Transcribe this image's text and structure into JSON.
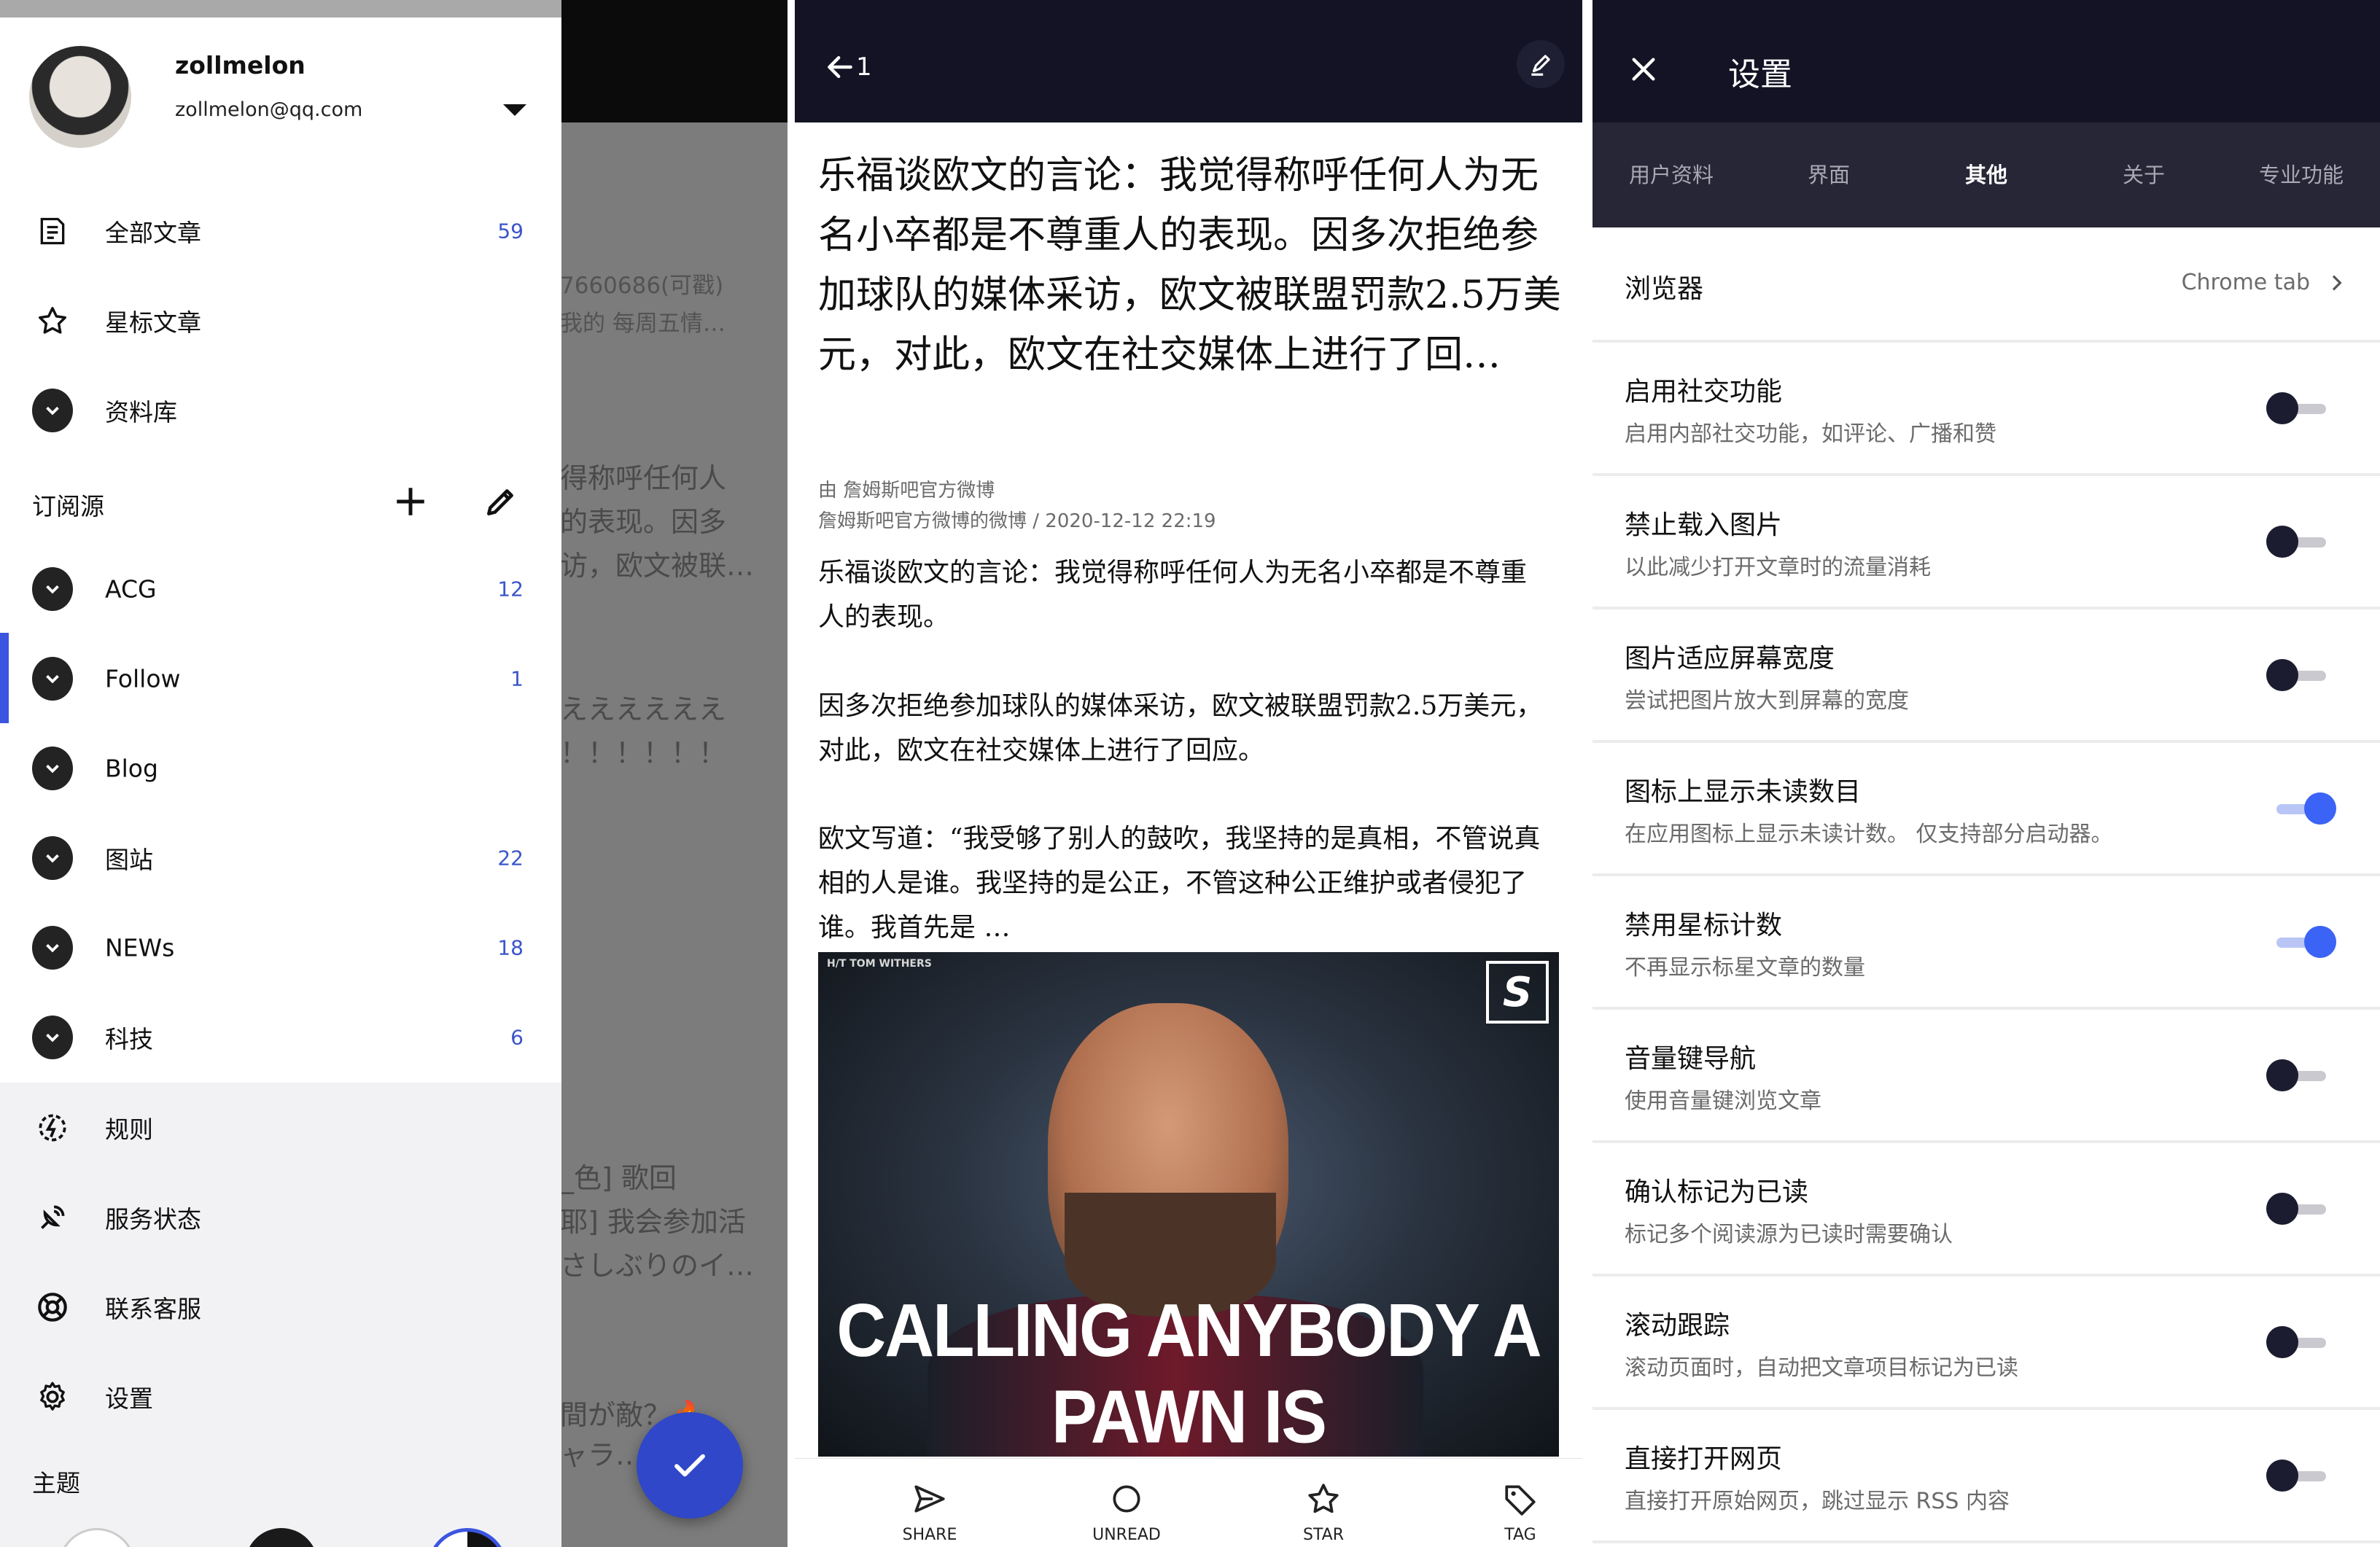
{
  "drawer": {
    "user": {
      "name": "zollmelon",
      "email": "zollmelon@qq.com"
    },
    "items": [
      {
        "label": "全部文章",
        "count": "59",
        "icon": "article-icon"
      },
      {
        "label": "星标文章",
        "count": "",
        "icon": "star-icon"
      },
      {
        "label": "资料库",
        "count": "",
        "icon": "chevron-down-icon"
      }
    ],
    "feeds_title": "订阅源",
    "feeds": [
      {
        "label": "ACG",
        "count": "12"
      },
      {
        "label": "Follow",
        "count": "1"
      },
      {
        "label": "Blog",
        "count": ""
      },
      {
        "label": "图站",
        "count": "22"
      },
      {
        "label": "NEWs",
        "count": "18"
      },
      {
        "label": "科技",
        "count": "6"
      }
    ],
    "bottom": [
      {
        "label": "规则",
        "icon": "rules-icon"
      },
      {
        "label": "服务状态",
        "icon": "satellite-icon"
      },
      {
        "label": "联系客服",
        "icon": "lifebuoy-icon"
      },
      {
        "label": "设置",
        "icon": "gear-icon"
      }
    ],
    "theme_title": "主题"
  },
  "background_list": [
    "7660686(可戳)",
    "我的 每周五情…",
    "得称呼任何人",
    "的表现。因多",
    "访，欧文被联…",
    "ええええええ",
    "！！！！！！",
    "_色]  歌回",
    "耶] 我会参加活",
    "さしぶりのイ…",
    "間が敵？🔥",
    "ャラ…"
  ],
  "article": {
    "unread_count": "1",
    "title": "乐福谈欧文的言论：我觉得称呼任何人为无名小卒都是不尊重人的表现。因多次拒绝参加球队的媒体采访，欧文被联盟罚款2.5万美元，对此，欧文在社交媒体上进行了回…",
    "meta_line1": "由 詹姆斯吧官方微博",
    "meta_line2": "詹姆斯吧官方微博的微博 / 2020-12-12 22:19",
    "paragraphs": [
      "乐福谈欧文的言论：我觉得称呼任何人为无名小卒都是不尊重人的表现。",
      "因多次拒绝参加球队的媒体采访，欧文被联盟罚款2.5万美元，对此，欧文在社交媒体上进行了回应。",
      "欧文写道：“我受够了别人的鼓吹，我坚持的是真相，不管说真相的人是谁。我坚持的是公正，不管这种公正维护或者侵犯了谁。我首先是 …"
    ],
    "image": {
      "credit": "H/T TOM WITHERS",
      "logo": "S",
      "caption": "CALLING ANYBODY A PAWN IS"
    },
    "toolbar": [
      {
        "label": "SHARE",
        "icon": "send-icon"
      },
      {
        "label": "UNREAD",
        "icon": "circle-icon"
      },
      {
        "label": "STAR",
        "icon": "star-icon"
      },
      {
        "label": "TAG",
        "icon": "tag-icon"
      }
    ]
  },
  "settings": {
    "title": "设置",
    "tabs": [
      "用户资料",
      "界面",
      "其他",
      "关于",
      "专业功能"
    ],
    "active_tab": "其他",
    "browser": {
      "label": "浏览器",
      "value": "Chrome tab"
    },
    "rows": [
      {
        "title": "启用社交功能",
        "sub": "启用内部社交功能，如评论、广播和赞",
        "on": false
      },
      {
        "title": "禁止载入图片",
        "sub": "以此减少打开文章时的流量消耗",
        "on": false
      },
      {
        "title": "图片适应屏幕宽度",
        "sub": "尝试把图片放大到屏幕的宽度",
        "on": false
      },
      {
        "title": "图标上显示未读数目",
        "sub": "在应用图标上显示未读计数。 仅支持部分启动器。",
        "on": true
      },
      {
        "title": "禁用星标计数",
        "sub": "不再显示标星文章的数量",
        "on": true
      },
      {
        "title": "音量键导航",
        "sub": "使用音量键浏览文章",
        "on": false
      },
      {
        "title": "确认标记为已读",
        "sub": "标记多个阅读源为已读时需要确认",
        "on": false
      },
      {
        "title": "滚动跟踪",
        "sub": "滚动页面时，自动把文章项目标记为已读",
        "on": false
      },
      {
        "title": "直接打开网页",
        "sub": "直接打开原始网页，跳过显示 RSS 内容",
        "on": false
      }
    ]
  },
  "colors": {
    "accent": "#3b55e0",
    "toolbar_dark": "#131325",
    "tab_bg": "#272636",
    "toggle_on": "#3b63f5"
  }
}
